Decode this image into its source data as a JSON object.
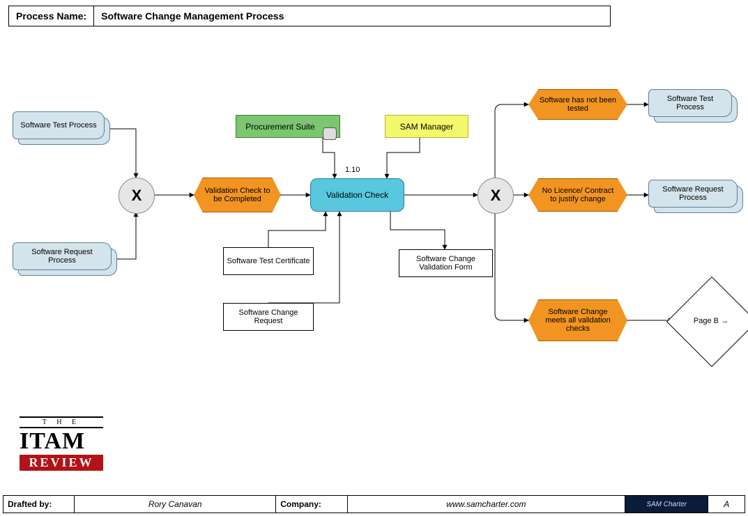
{
  "header": {
    "label": "Process Name:",
    "title": "Software Change Management Process"
  },
  "nodes": {
    "software_test_process_in": "Software Test Process",
    "software_request_process_in": "Software Request Process",
    "gateway1": "X",
    "validation_to_complete": "Validation Check to be Completed",
    "procurement_suite": "Procurement Suite",
    "sam_manager": "SAM Manager",
    "validation_check_num": "1.10",
    "validation_check": "Validation Check",
    "software_test_certificate": "Software Test Certificate",
    "software_change_request": "Software Change Request",
    "software_change_validation_form": "Software Change Validation Form",
    "gateway2": "X",
    "software_not_tested": "Software has not been tested",
    "no_licence": "No Licence/ Contract to justify change",
    "change_meets_checks": "Software Change meets all validation checks",
    "software_test_process_out": "Software Test Process",
    "software_request_process_out": "Software Request Process",
    "page_b": "Page B  →"
  },
  "logo": {
    "the": "T H E",
    "itam": "ITAM",
    "review": "REVIEW"
  },
  "footer": {
    "drafted_by_label": "Drafted by:",
    "drafted_by": "Rory Canavan",
    "company_label": "Company:",
    "company": "www.samcharter.com",
    "badge": "SAM Charter",
    "rev": "A"
  }
}
